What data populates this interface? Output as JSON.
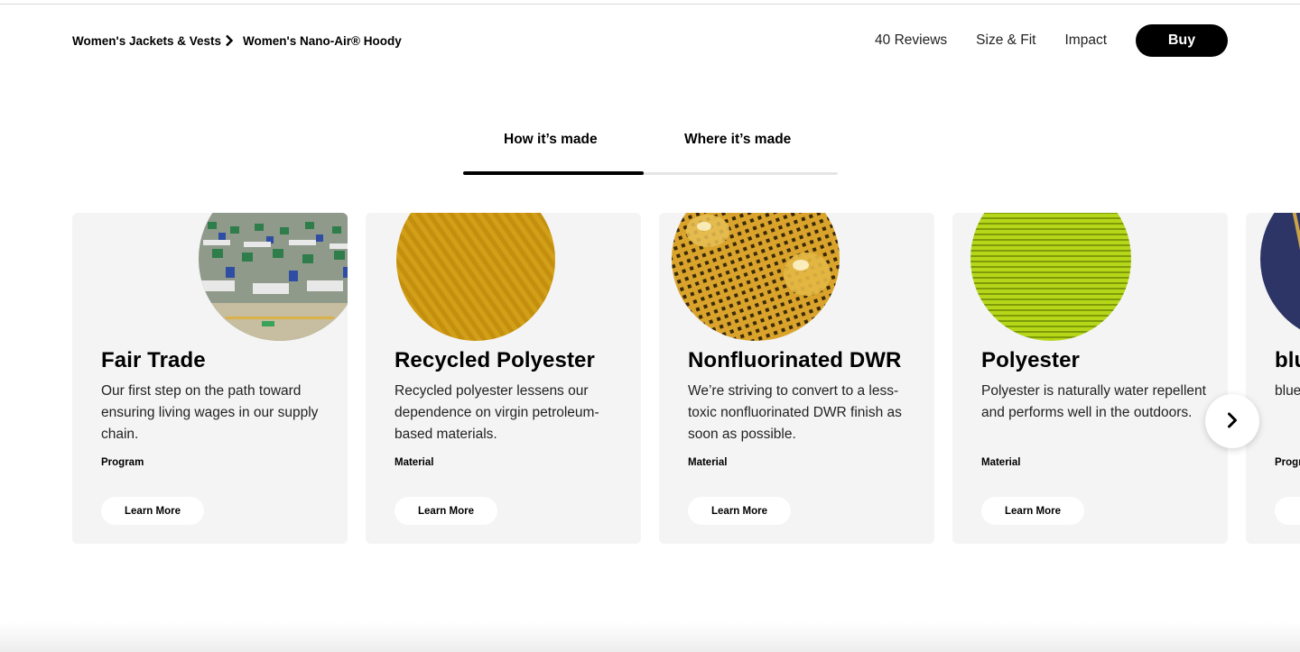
{
  "breadcrumb": {
    "parent": "Women's Jackets & Vests",
    "current": "Women's Nano-Air® Hoody",
    "separator_icon": "chevron-right-icon"
  },
  "nav": {
    "reviews": "40 Reviews",
    "size_fit": "Size & Fit",
    "impact": "Impact",
    "buy": "Buy"
  },
  "tabs": [
    {
      "label": "How it’s made",
      "active": true
    },
    {
      "label": "Where it’s made",
      "active": false
    }
  ],
  "cards": [
    {
      "title": "Fair Trade",
      "description": "Our first step on the path toward ensuring living wages in our supply chain.",
      "tag": "Program",
      "button": "Learn More",
      "image": "factory-workers-photo"
    },
    {
      "title": "Recycled Polyester",
      "description": "Recycled polyester lessens our dependence on virgin petroleum-based materials.",
      "tag": "Material",
      "button": "Learn More",
      "image": "yellow-fabric-photo"
    },
    {
      "title": "Nonfluorinated DWR",
      "description": "We’re striving to convert to a less-toxic nonfluorinated DWR finish as soon as possible.",
      "tag": "Material",
      "button": "Learn More",
      "image": "water-droplets-fabric-photo"
    },
    {
      "title": "Polyester",
      "description": "Polyester is naturally water repellent and performs well in the outdoors.",
      "tag": "Material",
      "button": "Learn More",
      "image": "green-fabric-photo"
    },
    {
      "title": "blu",
      "description": "blue chai are",
      "tag": "Progr",
      "button": "L",
      "image": "navy-fabric-photo"
    }
  ],
  "carousel": {
    "next_icon": "chevron-right-icon"
  },
  "colors": {
    "card_bg": "#f4f4f4",
    "primary": "#000000",
    "tab_track": "#e5e5e5"
  }
}
